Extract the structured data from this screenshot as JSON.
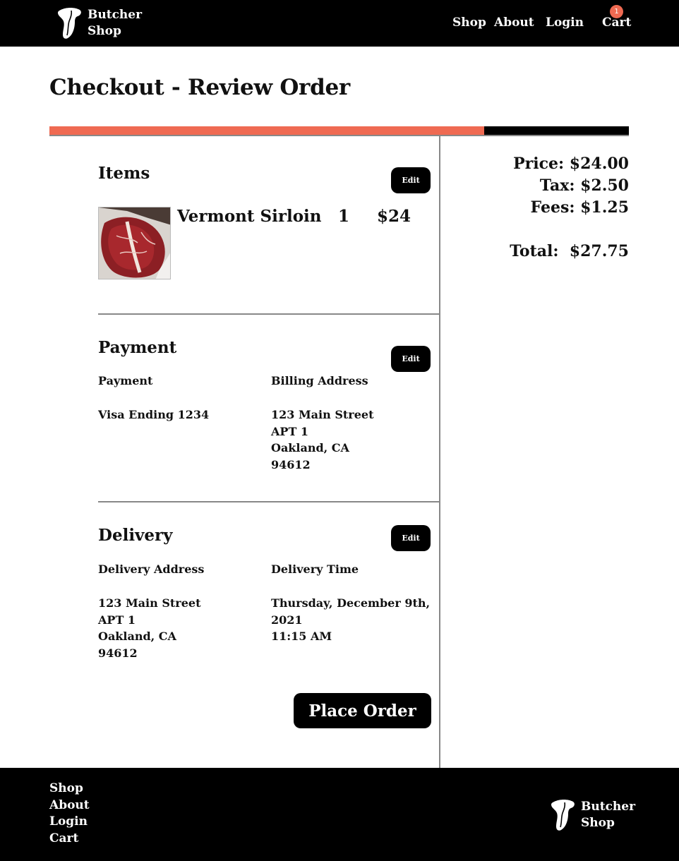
{
  "brand": {
    "line1": "Butcher",
    "line2": "Shop"
  },
  "nav": {
    "shop": "Shop",
    "about": "About",
    "login": "Login",
    "cart": "Cart",
    "cart_count": "1"
  },
  "page": {
    "title": "Checkout - Review Order",
    "progress_percent": 75
  },
  "items_section": {
    "heading": "Items",
    "edit_label": "Edit",
    "items": [
      {
        "name": "Vermont Sirloin",
        "quantity": "1",
        "price": "$24"
      }
    ]
  },
  "payment_section": {
    "heading": "Payment",
    "edit_label": "Edit",
    "payment_label": "Payment",
    "payment_value": "Visa Ending 1234",
    "billing_label": "Billing Address",
    "billing_lines": [
      "123 Main Street",
      "APT 1",
      "Oakland, CA",
      "94612"
    ]
  },
  "delivery_section": {
    "heading": "Delivery",
    "edit_label": "Edit",
    "address_label": "Delivery Address",
    "address_lines": [
      "123 Main Street",
      "APT 1",
      "Oakland, CA",
      "94612"
    ],
    "time_label": "Delivery Time",
    "time_lines": [
      "Thursday, December 9th,",
      "2021",
      "11:15 AM"
    ]
  },
  "summary": {
    "price": "Price: $24.00",
    "tax": "Tax: $2.50",
    "fees": "Fees: $1.25",
    "total": "Total:  $27.75"
  },
  "place_order_label": "Place Order",
  "footer": {
    "links": [
      "Shop",
      "About",
      "Login",
      "Cart"
    ]
  },
  "colors": {
    "accent": "#ef6a52",
    "header_bg": "#000000",
    "divider": "#888888"
  }
}
